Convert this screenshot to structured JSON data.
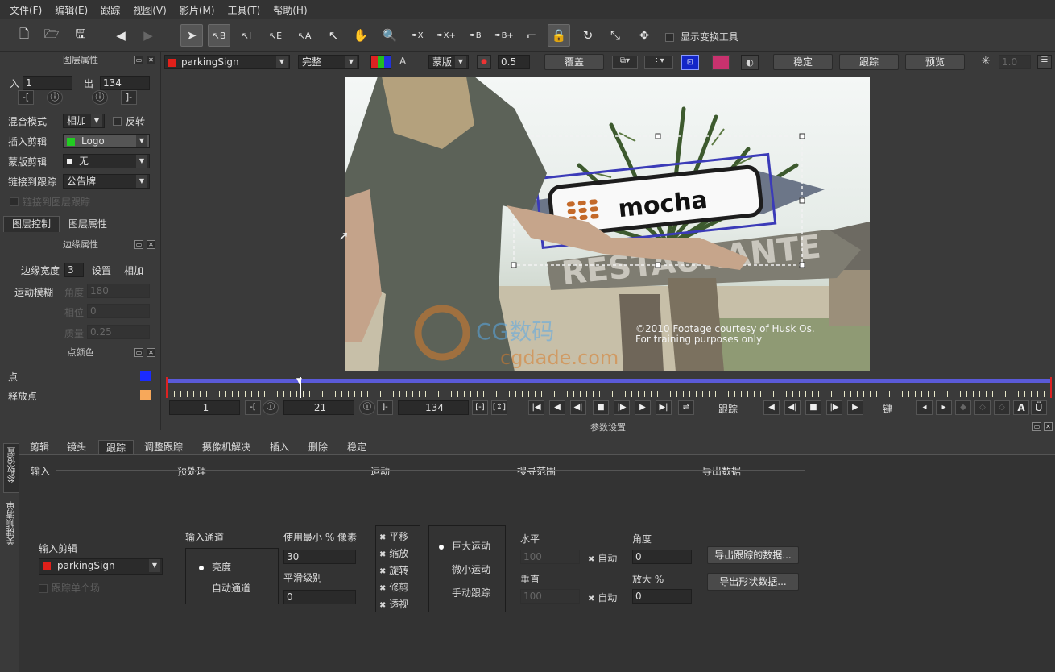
{
  "menu": [
    "文件(F)",
    "编辑(E)",
    "跟踪",
    "视图(V)",
    "影片(M)",
    "工具(T)",
    "帮助(H)"
  ],
  "toolbar": {
    "show_transform": "显示变换工具",
    "tool_labels": [
      "B",
      "I",
      "E",
      "A",
      "X",
      "X+",
      "B",
      "B+"
    ]
  },
  "layer_props": {
    "title": "图层属性",
    "in_label": "入",
    "in_value": "1",
    "out_label": "出",
    "out_value": "134",
    "blend_label": "混合模式",
    "blend_value": "相加",
    "invert_label": "反转",
    "insert_clip_label": "插入剪辑",
    "insert_clip_value": "Logo",
    "matte_clip_label": "蒙版剪辑",
    "matte_clip_value": "无",
    "link_track_label": "链接到跟踪",
    "link_track_value": "公告牌",
    "link_disabled": "链接到图层跟踪",
    "tab_control": "图层控制",
    "tab_props": "图层属性"
  },
  "edge_props": {
    "title": "边缘属性",
    "width_label": "边缘宽度",
    "width_value": "3",
    "set_label": "设置",
    "add_label": "相加",
    "motion_blur_label": "运动模糊",
    "angle_label": "角度",
    "angle_value": "180",
    "phase_label": "相位",
    "phase_value": "0",
    "quality_label": "质量",
    "quality_value": "0.25"
  },
  "point_color": {
    "title": "点颜色",
    "point_label": "点",
    "release_label": "释放点",
    "point_color": "#1a2bff",
    "release_color": "#f7a85a"
  },
  "ctl": {
    "clip": "parkingSign",
    "view_mode": "完整",
    "channel_a": "A",
    "matte": "蒙版",
    "opacity": "0.5",
    "overlay": "覆盖",
    "stabilize": "稳定",
    "track": "跟踪",
    "preview": "预览",
    "zoom": "1.0"
  },
  "video": {
    "credit1": "©2010 Footage courtesy of Husk Os.",
    "credit2": "For training purposes only",
    "sign": "mocha",
    "sign_back": "RESTAURANTE",
    "watermark1": "CG数码",
    "watermark2": "cgdade.com"
  },
  "timeline": {
    "start": "1",
    "current": "21",
    "end": "134",
    "track_label": "跟踪",
    "key_label": "键",
    "a": "A",
    "u": "Ü"
  },
  "bottom": {
    "title": "参数设置",
    "side_tab1": "参数设置",
    "side_tab2": "关键帧清单",
    "tabs": [
      "剪辑",
      "镜头",
      "跟踪",
      "调整跟踪",
      "摄像机解决",
      "插入",
      "删除",
      "稳定"
    ],
    "active_tab": 2,
    "sections": {
      "input": "输入",
      "preprocess": "预处理",
      "motion": "运动",
      "search": "搜寻范围",
      "export": "导出数据"
    },
    "input_clip_label": "输入剪辑",
    "input_clip_value": "parkingSign",
    "track_field": "跟踪单个场",
    "input_channel_label": "输入通道",
    "lum": "亮度",
    "auto_channel": "自动通道",
    "min_pixels_label": "使用最小 % 像素",
    "min_pixels_value": "30",
    "smooth_label": "平滑级别",
    "smooth_value": "0",
    "motion_opts": [
      "平移",
      "缩放",
      "旋转",
      "修剪",
      "透视"
    ],
    "large_motion": "巨大运动",
    "small_motion": "微小运动",
    "manual_track": "手动跟踪",
    "horizontal_label": "水平",
    "horizontal_value": "100",
    "vertical_label": "垂直",
    "vertical_value": "100",
    "auto": "自动",
    "angle_label": "角度",
    "angle_value": "0",
    "zoom_label": "放大 %",
    "zoom_value": "0",
    "export_tracking": "导出跟踪的数据...",
    "export_shape": "导出形状数据..."
  }
}
